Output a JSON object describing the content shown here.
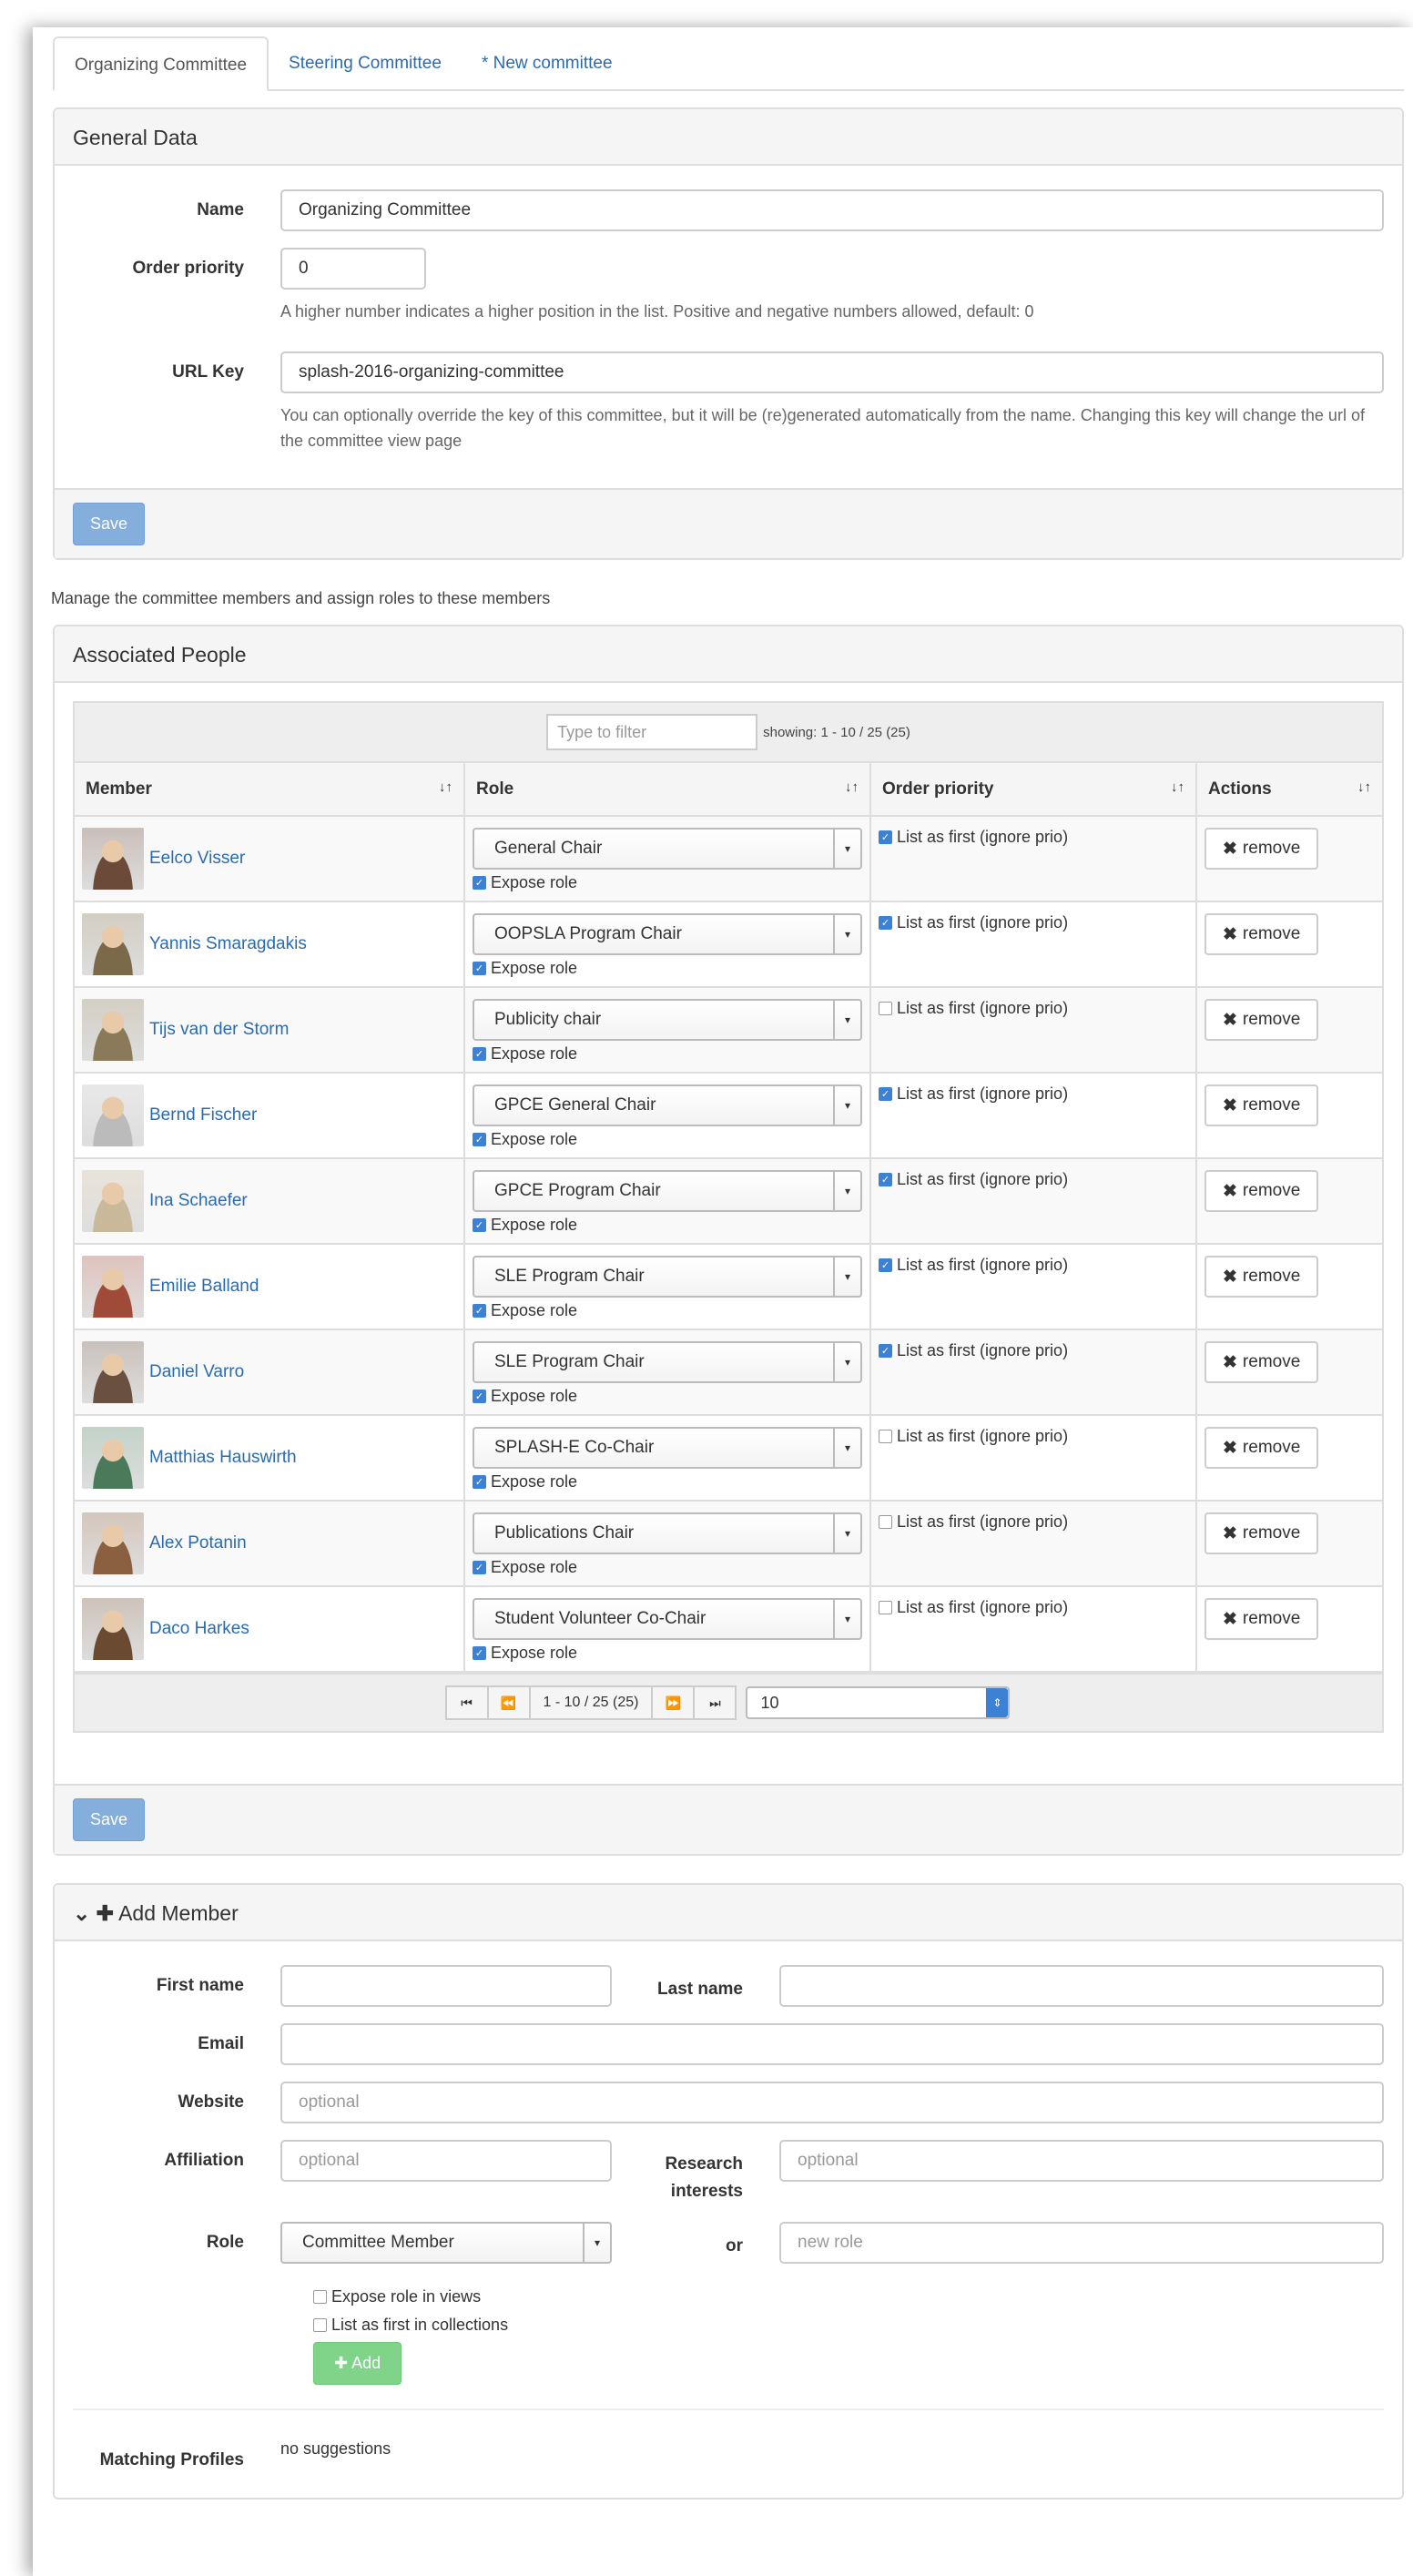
{
  "tabs": [
    "Organizing Committee",
    "Steering Committee",
    "* New committee"
  ],
  "general": {
    "heading": "General Data",
    "name_label": "Name",
    "name_value": "Organizing Committee",
    "priority_label": "Order priority",
    "priority_value": "0",
    "priority_help": "A higher number indicates a higher position in the list. Positive and negative numbers allowed, default: 0",
    "urlkey_label": "URL Key",
    "urlkey_value": "splash-2016-organizing-committee",
    "urlkey_help": "You can optionally override the key of this committee, but it will be (re)generated automatically from the name. Changing this key will change the url of the committee view page",
    "save": "Save"
  },
  "manage_note": "Manage the committee members and assign roles to these members",
  "people": {
    "heading": "Associated People",
    "filter_placeholder": "Type to filter",
    "showing": "showing: 1 - 10 / 25 (25)",
    "columns": [
      "Member",
      "Role",
      "Order priority",
      "Actions"
    ],
    "expose_label": "Expose role",
    "prio_label": "List as first (ignore prio)",
    "remove_label": "remove",
    "rows": [
      {
        "name": "Eelco Visser",
        "role": "General Chair",
        "first": true,
        "color": "#6b4a3a"
      },
      {
        "name": "Yannis Smaragdakis",
        "role": "OOPSLA Program Chair",
        "first": true,
        "color": "#7a6a4a"
      },
      {
        "name": "Tijs van der Storm",
        "role": "Publicity chair",
        "first": false,
        "color": "#8a7a5a"
      },
      {
        "name": "Bernd Fischer",
        "role": "GPCE General Chair",
        "first": true,
        "color": "#bbbbbb"
      },
      {
        "name": "Ina Schaefer",
        "role": "GPCE Program Chair",
        "first": true,
        "color": "#c9b89a"
      },
      {
        "name": "Emilie Balland",
        "role": "SLE Program Chair",
        "first": true,
        "color": "#a04a3a"
      },
      {
        "name": "Daniel Varro",
        "role": "SLE Program Chair",
        "first": true,
        "color": "#6a5040"
      },
      {
        "name": "Matthias Hauswirth",
        "role": "SPLASH-E Co-Chair",
        "first": false,
        "color": "#4a7a5a"
      },
      {
        "name": "Alex Potanin",
        "role": "Publications Chair",
        "first": false,
        "color": "#8a6040"
      },
      {
        "name": "Daco Harkes",
        "role": "Student Volunteer Co-Chair",
        "first": false,
        "color": "#6a4a30"
      }
    ],
    "pager_info": "1 - 10 / 25 (25)",
    "page_size": "10",
    "save": "Save"
  },
  "add": {
    "heading": "Add Member",
    "first_name": "First name",
    "last_name": "Last name",
    "email": "Email",
    "website": "Website",
    "website_ph": "optional",
    "affiliation": "Affiliation",
    "affiliation_ph": "optional",
    "research": "Research interests",
    "research_ph": "optional",
    "role": "Role",
    "role_value": "Committee Member",
    "or": "or",
    "new_role_ph": "new role",
    "expose_views": "Expose role in views",
    "list_first": "List as first in collections",
    "add_btn": "Add",
    "matching": "Matching Profiles",
    "no_suggestions": "no suggestions"
  }
}
